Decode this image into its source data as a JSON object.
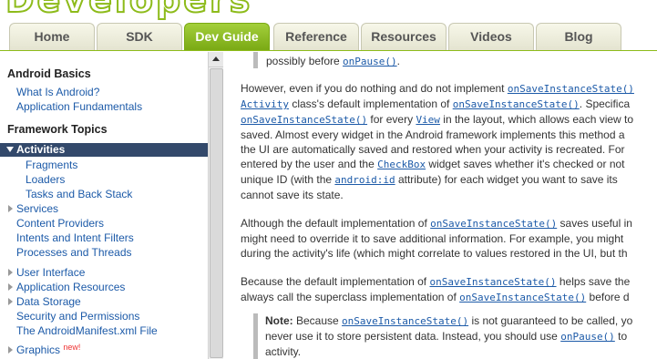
{
  "header": {
    "logo_text": "Developers",
    "tabs": [
      "Home",
      "SDK",
      "Dev Guide",
      "Reference",
      "Resources",
      "Videos",
      "Blog"
    ],
    "active_tab": "Dev Guide",
    "accent": "#8dbb1a"
  },
  "sidebar": {
    "android_basics": {
      "heading": "Android Basics",
      "items": [
        "What Is Android?",
        "Application Fundamentals"
      ]
    },
    "framework_topics": {
      "heading": "Framework Topics",
      "active": "Activities",
      "sub_items": [
        "Fragments",
        "Loaders",
        "Tasks and Back Stack"
      ],
      "group1": [
        "Services",
        "Content Providers",
        "Intents and Intent Filters",
        "Processes and Threads"
      ],
      "group2": [
        "User Interface",
        "Application Resources",
        "Data Storage",
        "Security and Permissions",
        "The AndroidManifest.xml File"
      ],
      "last": "Graphics",
      "new_badge": "new!"
    }
  },
  "content": {
    "top_note_prefix": "possibly before ",
    "top_note_code": "onPause()",
    "top_note_suffix": ".",
    "p1": {
      "l1a": "However, even if you do nothing and do not implement ",
      "l1code": "onSaveInstanceState()",
      "l2code": "Activity",
      "l2a": " class's default implementation of ",
      "l2code2": "onSaveInstanceState()",
      "l2b": ". Specifica",
      "l3code": "onSaveInstanceState()",
      "l3a": " for every ",
      "l3code2": "View",
      "l3b": " in the layout, which allows each view to",
      "l4": "saved. Almost every widget in the Android framework implements this method a",
      "l5": "the UI are automatically saved and restored when your activity is recreated. For",
      "l6a": "entered by the user and the ",
      "l6code": "CheckBox",
      "l6b": " widget saves whether it's checked or not",
      "l7a": "unique ID (with the ",
      "l7code": "android:id",
      "l7b": " attribute) for each widget you want to save its",
      "l8": "cannot save its state."
    },
    "p2": {
      "l1a": "Although the default implementation of ",
      "l1code": "onSaveInstanceState()",
      "l1b": " saves useful in",
      "l2": "might need to override it to save additional information. For example, you might",
      "l3": "during the activity's life (which might correlate to values restored in the UI, but th"
    },
    "p3": {
      "l1a": "Because the default implementation of ",
      "l1code": "onSaveInstanceState()",
      "l1b": " helps save the",
      "l2a": "always call the superclass implementation of ",
      "l2code": "onSaveInstanceState()",
      "l2b": " before d"
    },
    "note": {
      "label": "Note:",
      "l1a": " Because ",
      "l1code": "onSaveInstanceState()",
      "l1b": " is not guaranteed to be called, yo",
      "l2a": "never use it to store persistent data. Instead, you should use ",
      "l2code": "onPause()",
      "l2b": " to",
      "l3": "activity."
    }
  }
}
